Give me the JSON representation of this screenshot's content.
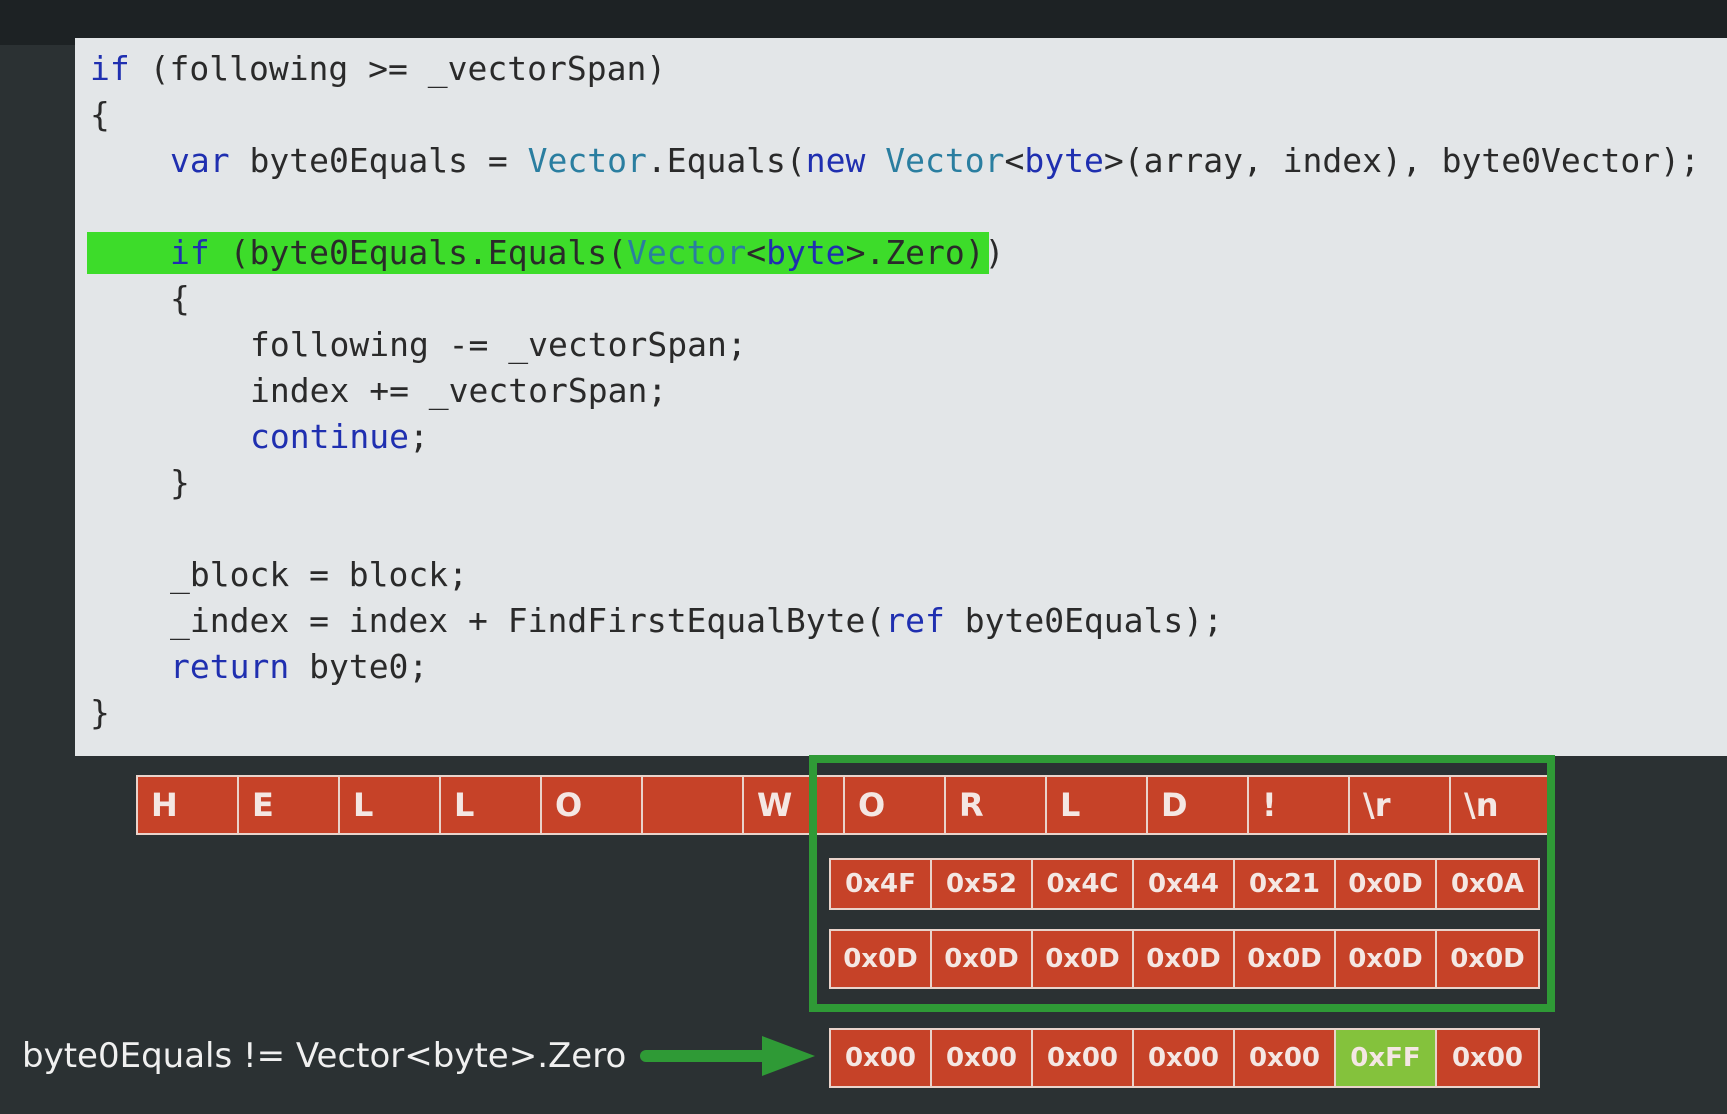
{
  "code": {
    "lines": [
      [
        {
          "t": "if",
          "c": "kw"
        },
        {
          "t": " (following >= _vectorSpan)",
          "c": "pl"
        }
      ],
      [
        {
          "t": "{",
          "c": "pl"
        }
      ],
      [
        {
          "t": "var",
          "c": "kw"
        },
        {
          "t": " byte0Equals = ",
          "c": "pl"
        },
        {
          "t": "Vector",
          "c": "ty"
        },
        {
          "t": ".Equals(",
          "c": "pl"
        },
        {
          "t": "new",
          "c": "kw"
        },
        {
          "t": " ",
          "c": "pl"
        },
        {
          "t": "Vector",
          "c": "ty"
        },
        {
          "t": "<",
          "c": "pl"
        },
        {
          "t": "byte",
          "c": "kw"
        },
        {
          "t": ">(array, index), byte0Vector);",
          "c": "pl"
        }
      ],
      [],
      [
        {
          "t": "if",
          "c": "kw"
        },
        {
          "t": " (byte0Equals.Equals(",
          "c": "pl"
        },
        {
          "t": "Vector",
          "c": "ty"
        },
        {
          "t": "<",
          "c": "pl"
        },
        {
          "t": "byte",
          "c": "kw"
        },
        {
          "t": ">.Zero))",
          "c": "pl"
        }
      ],
      [
        {
          "t": "{",
          "c": "pl"
        }
      ],
      [
        {
          "t": "following -= _vectorSpan;",
          "c": "pl"
        }
      ],
      [
        {
          "t": "index += _vectorSpan;",
          "c": "pl"
        }
      ],
      [
        {
          "t": "continue",
          "c": "kw"
        },
        {
          "t": ";",
          "c": "pl"
        }
      ],
      [
        {
          "t": "}",
          "c": "pl"
        }
      ],
      [],
      [
        {
          "t": "_block = block;",
          "c": "pl"
        }
      ],
      [
        {
          "t": "_index = index + FindFirstEqualByte(",
          "c": "pl"
        },
        {
          "t": "ref",
          "c": "kw"
        },
        {
          "t": " byte0Equals);",
          "c": "pl"
        }
      ],
      [
        {
          "t": "return",
          "c": "kw"
        },
        {
          "t": " byte0;",
          "c": "pl"
        }
      ],
      [
        {
          "t": "}",
          "c": "pl"
        }
      ]
    ],
    "highlighted_line": 4,
    "highlight_color": "#3ddc2a"
  },
  "chars": [
    "H",
    "E",
    "L",
    "L",
    "O",
    "",
    "W",
    "O",
    "R",
    "L",
    "D",
    "!",
    "\\r",
    "\\n"
  ],
  "hex_values": [
    "0x4F",
    "0x52",
    "0x4C",
    "0x44",
    "0x21",
    "0x0D",
    "0x0A"
  ],
  "search_vector": [
    "0x0D",
    "0x0D",
    "0x0D",
    "0x0D",
    "0x0D",
    "0x0D",
    "0x0D"
  ],
  "result": {
    "values": [
      "0x00",
      "0x00",
      "0x00",
      "0x00",
      "0x00",
      "0xFF",
      "0x00"
    ],
    "match_index": 5,
    "match_color": "#84c23c"
  },
  "caption": "byte0Equals != Vector<byte>.Zero",
  "colors": {
    "cell_red": "#c64228",
    "frame_green": "#2f9a36",
    "arrow_green": "#2f9a36",
    "keyword_blue": "#1f2fb0",
    "type_teal": "#2a7ea0",
    "slide_background": "#2b3133",
    "code_background": "#e3e6e8"
  }
}
